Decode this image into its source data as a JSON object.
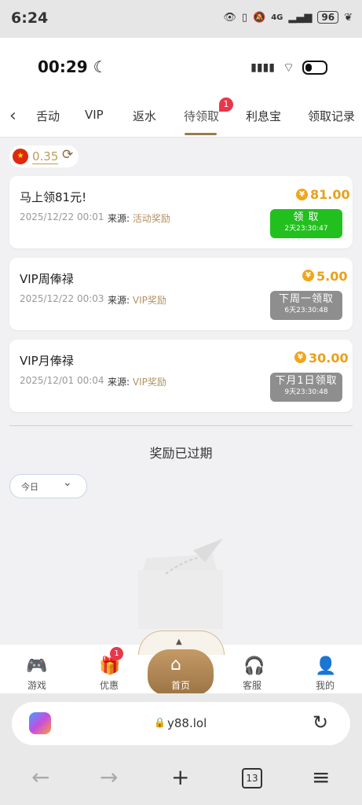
{
  "os": {
    "time": "6:24",
    "battery": "96",
    "network": "4G"
  },
  "app_status": {
    "time": "00:29"
  },
  "tabs": [
    {
      "label": "活动"
    },
    {
      "label": "VIP"
    },
    {
      "label": "返水"
    },
    {
      "label": "待领取",
      "badge": "1",
      "active": true
    },
    {
      "label": "利息宝"
    },
    {
      "label": "领取记录"
    }
  ],
  "tab_visible_first": "舌动",
  "balance": {
    "value": "0.35"
  },
  "rewards": [
    {
      "title": "马上领81元!",
      "date": "2025/12/22 00:01",
      "source_label": "来源:",
      "source": "活动奖励",
      "amount": "81.00",
      "button": "领 取",
      "countdown": "2天23:30:47",
      "state": "claimable"
    },
    {
      "title": "VIP周俸禄",
      "date": "2025/12/22 00:03",
      "source_label": "来源:",
      "source": "VIP奖励",
      "amount": "5.00",
      "button": "下周一领取",
      "countdown": "6天23:30:48",
      "state": "pending"
    },
    {
      "title": "VIP月俸禄",
      "date": "2025/12/01 00:04",
      "source_label": "来源:",
      "source": "VIP奖励",
      "amount": "30.00",
      "button": "下月1日领取",
      "countdown": "9天23:30:48",
      "state": "pending"
    }
  ],
  "expired": {
    "title": "奖励已过期",
    "filter": "今日"
  },
  "bottom_nav": {
    "items": [
      "游戏",
      "优惠",
      "首页",
      "客服",
      "我的"
    ],
    "promo_badge": "1"
  },
  "browser": {
    "url": "y88.lol",
    "tab_count": "13"
  }
}
